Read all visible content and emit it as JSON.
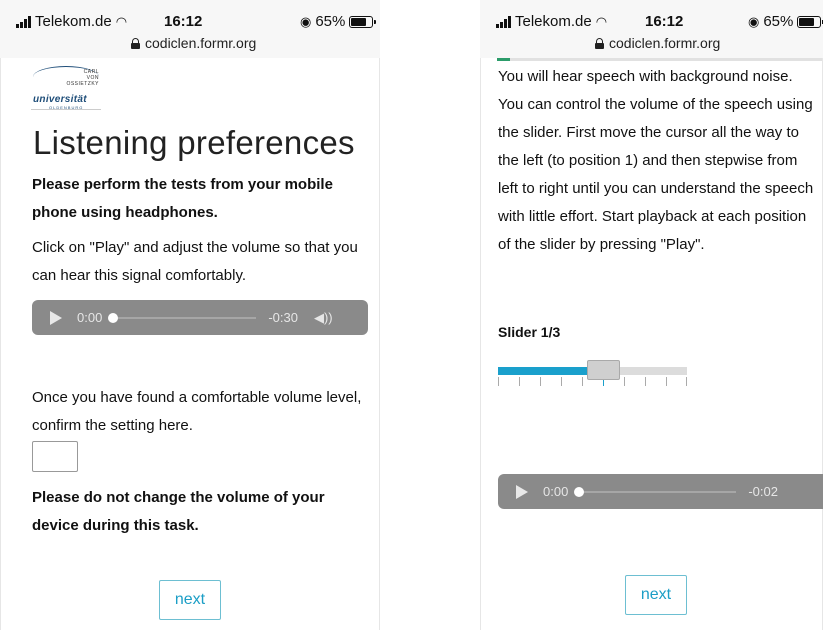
{
  "left": {
    "status": {
      "carrier": "Telekom.de",
      "time": "16:12",
      "battery": "65%",
      "url": "codiclen.formr.org"
    },
    "logo": {
      "line1": "CARL",
      "line2": "VON",
      "line3": "OSSIETZKY",
      "word": "universität",
      "sub": "OLDENBURG"
    },
    "title": "Listening preferences",
    "instruction_bold": "Please perform the tests from your mobile phone using headphones.",
    "instruction": "Click on \"Play\" and adjust the volume so that you can hear this signal comfortably.",
    "player": {
      "current": "0:00",
      "remaining": "-0:30",
      "position": 0.0
    },
    "confirm_text": "Once you have found a comfortable volume level, confirm the setting here.",
    "warning_bold": "Please do not change the volume of your device during this task.",
    "next_label": "next"
  },
  "right": {
    "status": {
      "carrier": "Telekom.de",
      "time": "16:12",
      "battery": "65%",
      "url": "codiclen.formr.org"
    },
    "progress": 0.04,
    "instruction": "You will hear speech with background noise. You can control the volume of the speech using the slider. First move the cursor all the way to the left (to position 1) and then stepwise from left to right until you can understand the speech with little effort. Start playback at each position of the slider by pressing \"Play\".",
    "slider": {
      "label": "Slider 1/3",
      "positions": 10,
      "value": 6
    },
    "player": {
      "current": "0:00",
      "remaining": "-0:02",
      "position": 0.0
    },
    "next_label": "next"
  },
  "colors": {
    "accent": "#1aa0cc",
    "progress": "#2c9c6a",
    "player_bg": "#8a8a8a"
  },
  "icons": {
    "play": "play-icon",
    "volume": "volume-icon",
    "lock": "lock-icon",
    "wifi": "wifi-icon",
    "battery": "battery-icon",
    "signal": "signal-icon"
  }
}
